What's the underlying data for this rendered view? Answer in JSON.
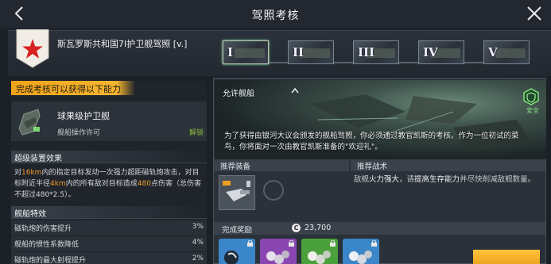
{
  "header": {
    "title": "驾照考核"
  },
  "license": {
    "name": "斯瓦罗斯共和国7I护卫舰驾照 [v.]",
    "tiers": [
      "I",
      "II",
      "III",
      "IV",
      "V"
    ],
    "active_tier": "I"
  },
  "left": {
    "reward_header": "完成考核可以获得以下能力",
    "ship_name": "球果级护卫舰",
    "ship_permit": "舰船操作许可",
    "unlock_label": "解锁",
    "super_device_title": "超级装置效果",
    "super_device_desc": {
      "p1": "对",
      "h1": "16km",
      "p2": "内的指定目标发动一次强力超距磁轨炮攻击，对目标附近半径",
      "h2": "4km",
      "p3": "内的所有敌对目标造成",
      "h3": "480",
      "p4": "点伤害（总伤害不超过480*2.5）。"
    },
    "traits_title": "舰船特效",
    "traits": [
      {
        "name": "磁轨炮的伤害提升",
        "value": "3%"
      },
      {
        "name": "舰船的惯性系数降低",
        "value": "4%"
      },
      {
        "name": "磁轨炮的最大射程提升",
        "value": "2%"
      }
    ]
  },
  "right": {
    "allowed_ships_label": "允许舰船",
    "safe_label": "安全",
    "story": "为了获得由银河大议会颁发的舰船驾照，你必须通过教官凯斯的考核。作为一位初试的菜鸟，你将面对一次由教官凯斯准备的\"欢迎礼\"。",
    "recommended_equipment_label": "推荐装备",
    "recommended_tactic_label": "推荐战术",
    "tactic": {
      "p1": "敌舰",
      "h1": "火力强大",
      "p2": "，请",
      "h2": "提高生存能力",
      "p3": "并尽快削减敌舰数量。"
    },
    "completion_reward_label": "完成奖励",
    "coin_symbol": "C",
    "coin_amount": "23,700"
  },
  "colors": {
    "accent_orange": "#f6b531",
    "highlight": "#f09a2a",
    "unlock_green": "#8dbb3a"
  }
}
